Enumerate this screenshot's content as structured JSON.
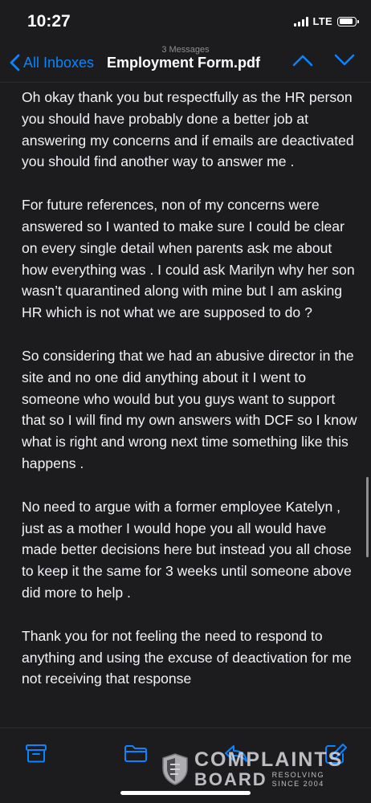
{
  "status_bar": {
    "time": "10:27",
    "network": "LTE",
    "battery_level": 0.85
  },
  "nav": {
    "message_count": "3 Messages",
    "back_label": "All Inboxes",
    "title": "Employment Form.pdf"
  },
  "message": {
    "paragraphs": [
      "Oh okay thank you but respectfully as the HR person you should have probably done a better job at answering my concerns and if emails are deactivated you should find another way to answer me .",
      "For future references,  non of my concerns were answered so I wanted to make sure I could be clear on every single detail when parents ask me about how everything was . I could ask Marilyn why her son wasn’t quarantined along with mine but I am asking HR which is not what we are supposed to do ?",
      "So considering that we had an abusive director in the site and no one did anything about it I went to someone who would but you guys want to support that so I will find my own answers with DCF so I know what is right and wrong next time something like this happens .",
      "No need to argue with a former employee Katelyn , just as a mother I would hope you all would have made better decisions here but instead you all chose to keep it the same for 3 weeks until someone above did more to help .",
      "Thank you for not feeling the need to respond to anything and using the excuse of deactivation for me not receiving that response"
    ]
  },
  "toolbar": {
    "icons": [
      "archive-icon",
      "folder-icon",
      "reply-icon",
      "compose-icon"
    ]
  },
  "watermark": {
    "line1": "COMPLAINTS",
    "line2": "BOARD",
    "tag1": "RESOLVING",
    "tag2": "SINCE 2004"
  },
  "colors": {
    "accent": "#0a84ff",
    "background": "#1c1c1e",
    "text": "#f2f2f7"
  }
}
